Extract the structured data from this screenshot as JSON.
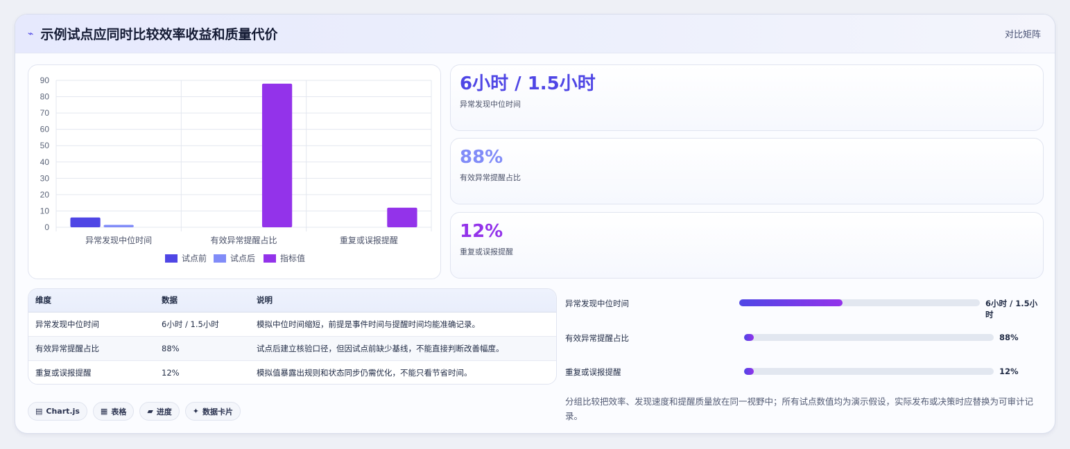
{
  "header": {
    "icon": "bolt-icon",
    "title": "示例试点应同时比较效率收益和质量代价",
    "tag": "对比矩阵"
  },
  "chart_data": {
    "type": "bar",
    "categories": [
      "异常发现中位时间",
      "有效异常提醒占比",
      "重复或误报提醒"
    ],
    "series": [
      {
        "name": "试点前",
        "color": "#4f46e5",
        "values": [
          6,
          null,
          null
        ]
      },
      {
        "name": "试点后",
        "color": "#818cf8",
        "values": [
          1.5,
          null,
          null
        ]
      },
      {
        "name": "指标值",
        "color": "#9333ea",
        "values": [
          null,
          88,
          12
        ]
      }
    ],
    "ylim": [
      0,
      90
    ],
    "yticks": [
      "0",
      "10",
      "20",
      "30",
      "40",
      "50",
      "60",
      "70",
      "80",
      "90"
    ],
    "legend": "bottom",
    "grid": true
  },
  "kpis": [
    {
      "value": "6小时 / 1.5小时",
      "label": "异常发现中位时间",
      "color": "#4f46e5"
    },
    {
      "value": "88%",
      "label": "有效异常提醒占比",
      "color": "#818cf8"
    },
    {
      "value": "12%",
      "label": "重复或误报提醒",
      "color": "#9333ea"
    }
  ],
  "table": {
    "headers": [
      "维度",
      "数据",
      "说明"
    ],
    "rows": [
      [
        "异常发现中位时间",
        "6小时 / 1.5小时",
        "模拟中位时间缩短，前提是事件时间与提醒时间均能准确记录。"
      ],
      [
        "有效异常提醒占比",
        "88%",
        "试点后建立核验口径，但因试点前缺少基线，不能直接判断改善幅度。"
      ],
      [
        "重复或误报提醒",
        "12%",
        "模拟值暴露出规则和状态同步仍需优化，不能只看节省时间。"
      ]
    ]
  },
  "chips": [
    {
      "icon": "▤",
      "label": "Chart.js"
    },
    {
      "icon": "▦",
      "label": "表格"
    },
    {
      "icon": "▰",
      "label": "进度"
    },
    {
      "icon": "✦",
      "label": "数据卡片"
    }
  ],
  "progress": [
    {
      "label": "异常发现中位时间",
      "value": "6小时 / 1.5小时",
      "fraction": 0.43
    },
    {
      "label": "有效异常提醒占比",
      "value": "88%",
      "fraction": 0.04
    },
    {
      "label": "重复或误报提醒",
      "value": "12%",
      "fraction": 0.04
    }
  ],
  "note": "分组比较把效率、发现速度和提醒质量放在同一视野中；所有试点数值均为演示假设，实际发布或决策时应替换为可审计记录。"
}
